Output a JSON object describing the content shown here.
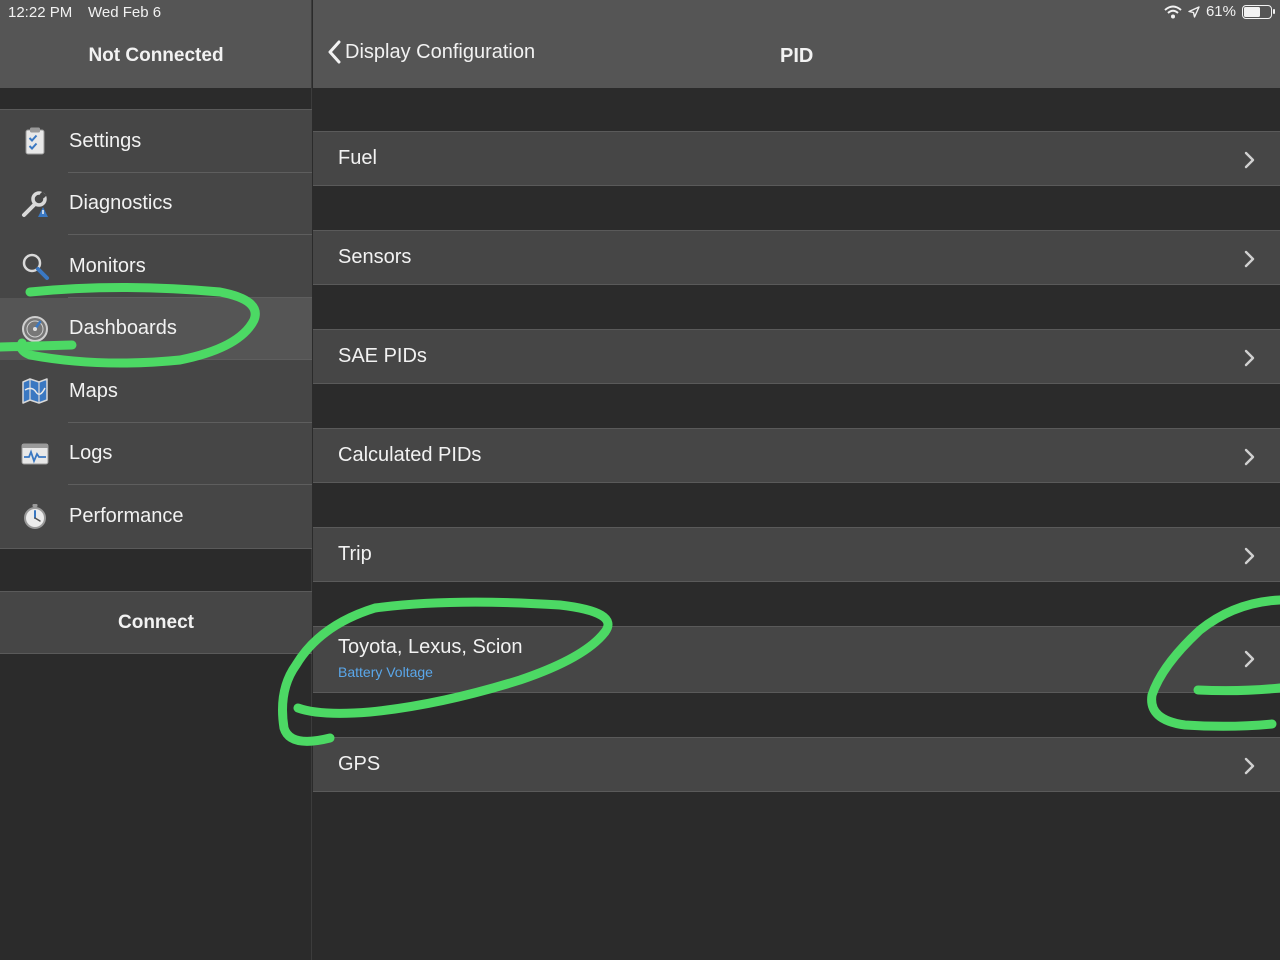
{
  "status_bar": {
    "time": "12:22 PM",
    "date": "Wed Feb 6",
    "battery_text": "61%",
    "battery_level": 0.61
  },
  "sidebar": {
    "title": "Not Connected",
    "items": [
      {
        "label": "Settings",
        "icon": "clipboard-check-icon"
      },
      {
        "label": "Diagnostics",
        "icon": "wrench-warning-icon"
      },
      {
        "label": "Monitors",
        "icon": "magnifier-icon"
      },
      {
        "label": "Dashboards",
        "icon": "gauge-icon",
        "selected": true
      },
      {
        "label": "Maps",
        "icon": "map-icon"
      },
      {
        "label": "Logs",
        "icon": "pulse-chart-icon"
      },
      {
        "label": "Performance",
        "icon": "stopwatch-icon"
      }
    ],
    "connect_label": "Connect"
  },
  "main": {
    "back_label": "Display Configuration",
    "title": "PID",
    "rows": [
      {
        "label": "Fuel"
      },
      {
        "label": "Sensors"
      },
      {
        "label": "SAE PIDs"
      },
      {
        "label": "Calculated PIDs"
      },
      {
        "label": "Trip"
      },
      {
        "label": "Toyota, Lexus, Scion",
        "sublabel": "Battery Voltage"
      },
      {
        "label": "GPS"
      }
    ]
  },
  "colors": {
    "highlight_marker": "#4cd964",
    "sublabel_blue": "#5aa7ea",
    "header_gray": "#555555",
    "cell_gray": "#464646",
    "background": "#2b2b2b"
  }
}
